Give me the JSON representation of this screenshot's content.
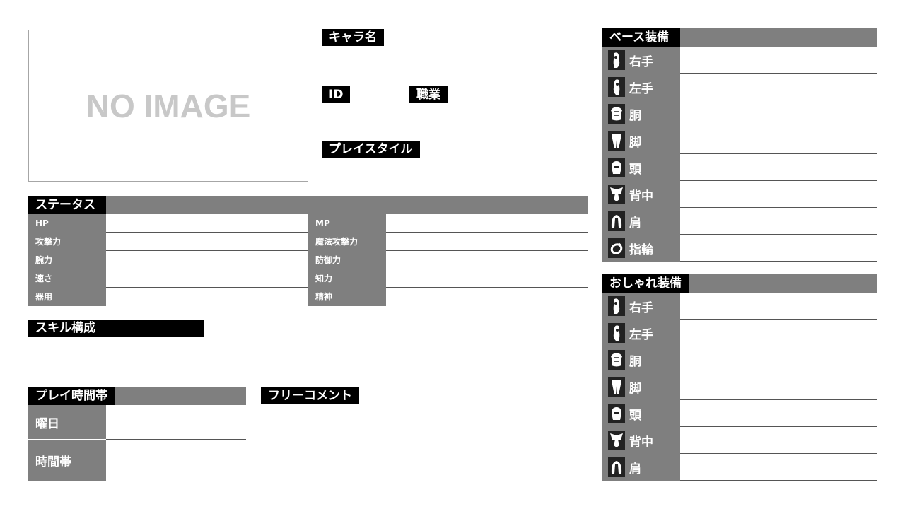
{
  "image_placeholder": "NO IMAGE",
  "profile": {
    "name_label": "キャラ名",
    "id_label": "ID",
    "job_label": "職業",
    "playstyle_label": "プレイスタイル"
  },
  "status": {
    "title": "ステータス",
    "left": [
      "HP",
      "攻撃力",
      "腕力",
      "速さ",
      "器用"
    ],
    "right": [
      "MP",
      "魔法攻撃力",
      "防御力",
      "知力",
      "精神"
    ]
  },
  "skills": {
    "title": "スキル構成"
  },
  "playtime": {
    "title": "プレイ時間帯",
    "rows": [
      "曜日",
      "時間帯"
    ]
  },
  "comment": {
    "title": "フリーコメント"
  },
  "base_equipment": {
    "title": "ベース装備",
    "slots": [
      {
        "label": "右手",
        "icon": "right-hand-icon"
      },
      {
        "label": "左手",
        "icon": "left-hand-icon"
      },
      {
        "label": "胴",
        "icon": "body-armor-icon"
      },
      {
        "label": "脚",
        "icon": "legs-icon"
      },
      {
        "label": "頭",
        "icon": "head-icon"
      },
      {
        "label": "背中",
        "icon": "back-icon"
      },
      {
        "label": "肩",
        "icon": "shoulder-icon"
      },
      {
        "label": "指輪",
        "icon": "ring-icon"
      }
    ]
  },
  "fashion_equipment": {
    "title": "おしゃれ装備",
    "slots": [
      {
        "label": "右手",
        "icon": "right-hand-icon"
      },
      {
        "label": "左手",
        "icon": "left-hand-icon"
      },
      {
        "label": "胴",
        "icon": "body-armor-icon"
      },
      {
        "label": "脚",
        "icon": "legs-icon"
      },
      {
        "label": "頭",
        "icon": "head-icon"
      },
      {
        "label": "背中",
        "icon": "back-icon"
      },
      {
        "label": "肩",
        "icon": "shoulder-icon"
      }
    ]
  }
}
